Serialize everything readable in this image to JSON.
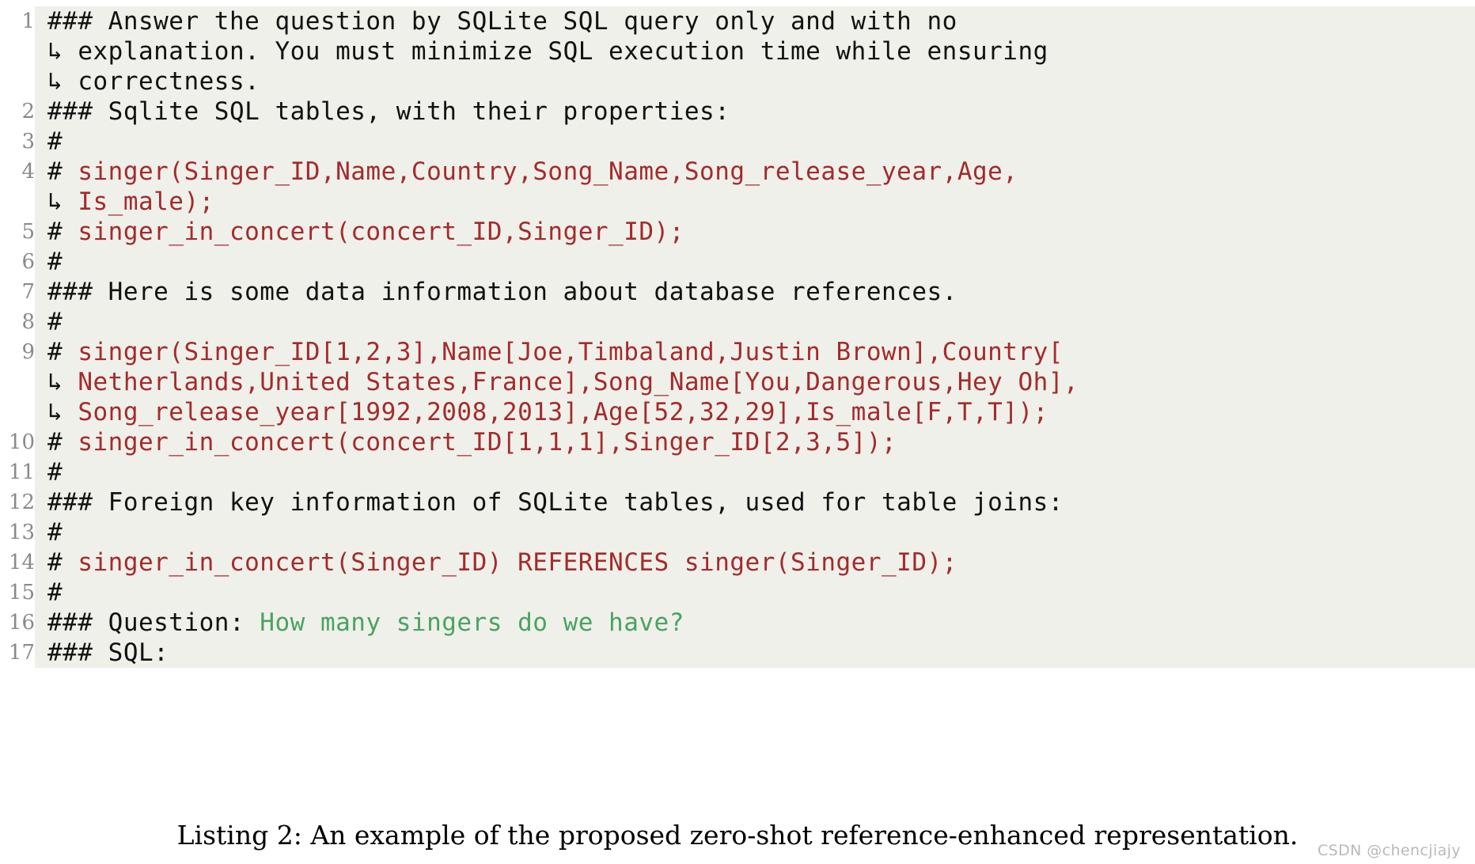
{
  "colors": {
    "background": "#ffffff",
    "code_background": "#f0f0ea",
    "plain_text": "#111111",
    "schema_red": "#a32b2b",
    "question_green": "#49a361",
    "line_number": "#8a8a8a",
    "watermark": "#b9b9b9"
  },
  "listing": {
    "continuation_glyph": "↳",
    "lines": [
      {
        "number": "1",
        "rows": [
          {
            "gutter": "1",
            "segments": [
              {
                "text": "### Answer the question by SQLite SQL query only and with no",
                "color": "plain"
              }
            ]
          },
          {
            "gutter": "",
            "continuation": true,
            "segments": [
              {
                "text": "explanation. You must minimize SQL execution time while ensuring",
                "color": "plain"
              }
            ]
          },
          {
            "gutter": "",
            "continuation": true,
            "segments": [
              {
                "text": "correctness.",
                "color": "plain"
              }
            ]
          }
        ]
      },
      {
        "number": "2",
        "rows": [
          {
            "gutter": "2",
            "segments": [
              {
                "text": "### Sqlite SQL tables, with their properties:",
                "color": "plain"
              }
            ]
          }
        ]
      },
      {
        "number": "3",
        "rows": [
          {
            "gutter": "3",
            "segments": [
              {
                "text": "#",
                "color": "plain"
              }
            ]
          }
        ]
      },
      {
        "number": "4",
        "rows": [
          {
            "gutter": "4",
            "segments": [
              {
                "text": "# ",
                "color": "plain"
              },
              {
                "text": "singer(Singer_ID,Name,Country,Song_Name,Song_release_year,Age,",
                "color": "red"
              }
            ]
          },
          {
            "gutter": "",
            "continuation": true,
            "segments": [
              {
                "text": "Is_male);",
                "color": "red"
              }
            ]
          }
        ]
      },
      {
        "number": "5",
        "rows": [
          {
            "gutter": "5",
            "segments": [
              {
                "text": "# ",
                "color": "plain"
              },
              {
                "text": "singer_in_concert(concert_ID,Singer_ID);",
                "color": "red"
              }
            ]
          }
        ]
      },
      {
        "number": "6",
        "rows": [
          {
            "gutter": "6",
            "segments": [
              {
                "text": "#",
                "color": "plain"
              }
            ]
          }
        ]
      },
      {
        "number": "7",
        "rows": [
          {
            "gutter": "7",
            "segments": [
              {
                "text": "### Here is some data information about database references.",
                "color": "plain"
              }
            ]
          }
        ]
      },
      {
        "number": "8",
        "rows": [
          {
            "gutter": "8",
            "segments": [
              {
                "text": "#",
                "color": "plain"
              }
            ]
          }
        ]
      },
      {
        "number": "9",
        "rows": [
          {
            "gutter": "9",
            "segments": [
              {
                "text": "# ",
                "color": "plain"
              },
              {
                "text": "singer(Singer_ID[1,2,3],Name[Joe,Timbaland,Justin Brown],Country[",
                "color": "red"
              }
            ]
          },
          {
            "gutter": "",
            "continuation": true,
            "segments": [
              {
                "text": "Netherlands,United States,France],Song_Name[You,Dangerous,Hey Oh],",
                "color": "red"
              }
            ]
          },
          {
            "gutter": "",
            "continuation": true,
            "segments": [
              {
                "text": "Song_release_year[1992,2008,2013],Age[52,32,29],Is_male[F,T,T]);",
                "color": "red"
              }
            ]
          }
        ]
      },
      {
        "number": "10",
        "rows": [
          {
            "gutter": "10",
            "segments": [
              {
                "text": "# ",
                "color": "plain"
              },
              {
                "text": "singer_in_concert(concert_ID[1,1,1],Singer_ID[2,3,5]);",
                "color": "red"
              }
            ]
          }
        ]
      },
      {
        "number": "11",
        "rows": [
          {
            "gutter": "11",
            "segments": [
              {
                "text": "#",
                "color": "plain"
              }
            ]
          }
        ]
      },
      {
        "number": "12",
        "rows": [
          {
            "gutter": "12",
            "segments": [
              {
                "text": "### Foreign key information of SQLite tables, used for table joins:",
                "color": "plain"
              }
            ]
          }
        ]
      },
      {
        "number": "13",
        "rows": [
          {
            "gutter": "13",
            "segments": [
              {
                "text": "#",
                "color": "plain"
              }
            ]
          }
        ]
      },
      {
        "number": "14",
        "rows": [
          {
            "gutter": "14",
            "segments": [
              {
                "text": "# ",
                "color": "plain"
              },
              {
                "text": "singer_in_concert(Singer_ID) REFERENCES singer(Singer_ID);",
                "color": "red"
              }
            ]
          }
        ]
      },
      {
        "number": "15",
        "rows": [
          {
            "gutter": "15",
            "segments": [
              {
                "text": "#",
                "color": "plain"
              }
            ]
          }
        ]
      },
      {
        "number": "16",
        "rows": [
          {
            "gutter": "16",
            "segments": [
              {
                "text": "### Question: ",
                "color": "plain"
              },
              {
                "text": "How many singers do we have?",
                "color": "green"
              }
            ]
          }
        ]
      },
      {
        "number": "17",
        "rows": [
          {
            "gutter": "17",
            "segments": [
              {
                "text": "### SQL:",
                "color": "plain"
              }
            ]
          }
        ]
      }
    ]
  },
  "caption": {
    "text": "Listing 2: An example of the proposed zero-shot reference-enhanced representation."
  },
  "watermark": {
    "text": "CSDN @chencjiajy"
  }
}
